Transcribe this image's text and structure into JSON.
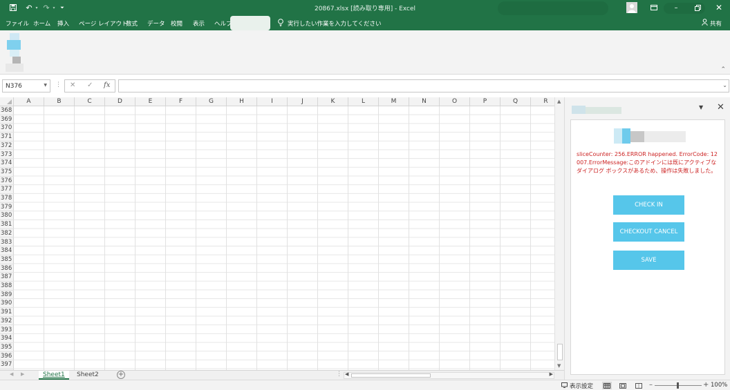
{
  "app": {
    "window_title": "20867.xlsx [読み取り専用] - Excel"
  },
  "ribbon_tabs": [
    "ファイル",
    "ホーム",
    "挿入",
    "ページ レイアウト",
    "数式",
    "データ",
    "校閲",
    "表示",
    "ヘルプ"
  ],
  "tell_me": "実行したい作業を入力してください",
  "share_label": "共有",
  "formula_bar": {
    "name_box": "N376",
    "fx_label": "fx",
    "formula": ""
  },
  "grid": {
    "columns": [
      "A",
      "B",
      "C",
      "D",
      "E",
      "F",
      "G",
      "H",
      "I",
      "J",
      "K",
      "L",
      "M",
      "N",
      "O",
      "P",
      "Q",
      "R"
    ],
    "rows": [
      "368",
      "369",
      "370",
      "371",
      "372",
      "373",
      "374",
      "375",
      "376",
      "377",
      "378",
      "379",
      "380",
      "381",
      "382",
      "383",
      "384",
      "385",
      "386",
      "387",
      "388",
      "389",
      "390",
      "391",
      "392",
      "393",
      "394",
      "395",
      "396",
      "397"
    ]
  },
  "sheets": {
    "tabs": [
      "Sheet1",
      "Sheet2"
    ],
    "active_index": 0
  },
  "status_bar": {
    "display_settings": "表示設定",
    "zoom": "100%"
  },
  "task_pane": {
    "error_message": "sliceCounter: 256.ERROR happened. ErrorCode: 12007.ErrorMessage:このアドインには既にアクティブなダイアログ ボックスがあるため、操作は失敗しました。",
    "buttons": {
      "check_in": "CHECK IN",
      "checkout_cancel": "CHECKOUT CANCEL",
      "save": "SAVE"
    },
    "button_color": "#56c6ea",
    "error_color": "#cc2222"
  },
  "colors": {
    "excel_green": "#217346"
  }
}
